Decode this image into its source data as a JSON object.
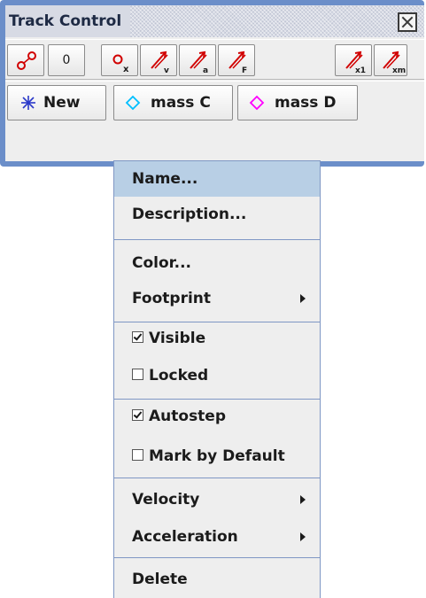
{
  "window": {
    "title": "Track Control",
    "close_icon": "close-icon"
  },
  "toolbar": {
    "buttons": [
      {
        "icon": "point-mass-icon"
      },
      {
        "label": "0"
      },
      {
        "icon": "center-of-mass-icon"
      },
      {
        "icon": "velocity-vector-icon"
      },
      {
        "icon": "acceleration-vector-icon"
      },
      {
        "icon": "force-vector-icon"
      },
      {
        "icon": "vector-sum-x1-icon"
      },
      {
        "icon": "vector-sum-xm-icon"
      }
    ]
  },
  "tracks": {
    "new_label": "New",
    "items": [
      {
        "label": "mass C",
        "color": "#00bfff"
      },
      {
        "label": "mass D",
        "color": "#ff00ff"
      }
    ]
  },
  "menu": {
    "name": "Name...",
    "description": "Description...",
    "color": "Color...",
    "footprint": "Footprint",
    "visible": "Visible",
    "visible_checked": true,
    "locked": "Locked",
    "locked_checked": false,
    "autostep": "Autostep",
    "autostep_checked": true,
    "mark_by_default": "Mark by Default",
    "mark_by_default_checked": false,
    "velocity": "Velocity",
    "acceleration": "Acceleration",
    "delete": "Delete"
  }
}
